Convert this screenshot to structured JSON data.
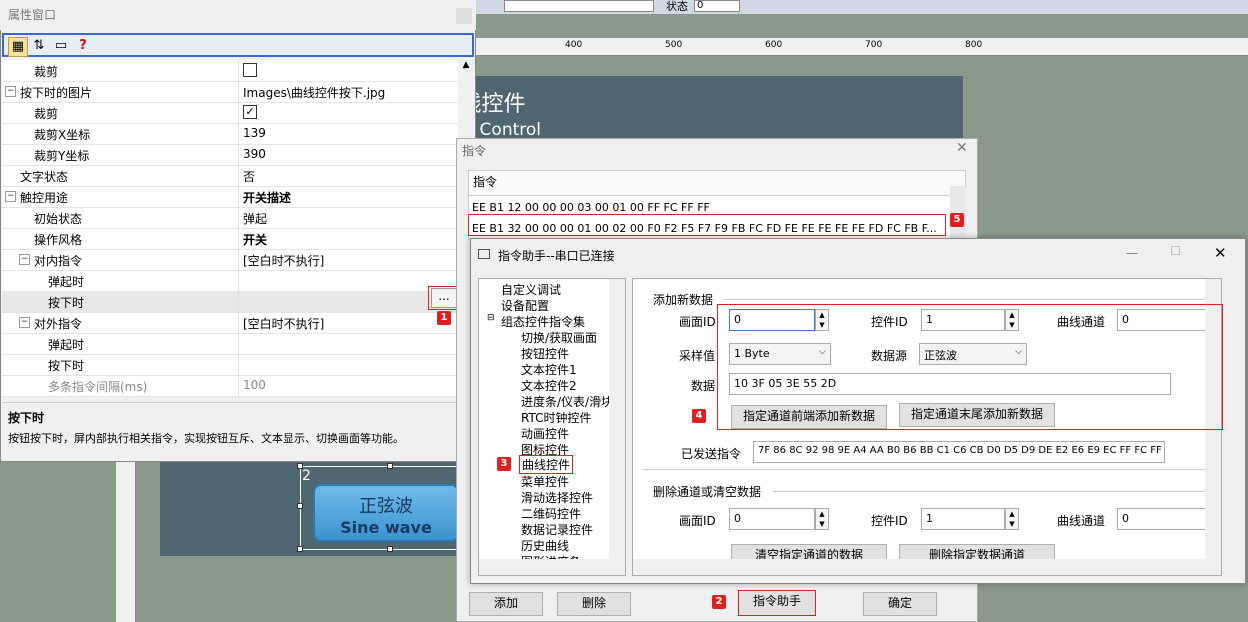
{
  "toolbar_top": {
    "status_label": "状态",
    "status_value": "0"
  },
  "ruler": {
    "ticks": [
      "400",
      "500",
      "600",
      "700",
      "800"
    ]
  },
  "canvas": {
    "title_cn": "曲线控件",
    "title_en": "Graph Control",
    "sine_cn": "正弦波",
    "sine_en": "Sine wave",
    "selection_index": "2"
  },
  "prop_window": {
    "title": "属性窗口",
    "rows": [
      {
        "key": "裁剪",
        "value": ""
      },
      {
        "key": "按下时的图片",
        "value": "Images\\曲线控件按下.jpg"
      },
      {
        "key": "裁剪",
        "value": "✓"
      },
      {
        "key": "裁剪X坐标",
        "value": "139"
      },
      {
        "key": "裁剪Y坐标",
        "value": "390"
      },
      {
        "key": "文字状态",
        "value": "否"
      },
      {
        "key": "触控用途",
        "value": "开关描述"
      },
      {
        "key": "初始状态",
        "value": "弹起"
      },
      {
        "key": "操作风格",
        "value": "开关"
      },
      {
        "key": "对内指令",
        "value": "[空白时不执行]"
      },
      {
        "key": "弹起时",
        "value": ""
      },
      {
        "key": "按下时",
        "value": ""
      },
      {
        "key": "对外指令",
        "value": "[空白时不执行]"
      },
      {
        "key": "弹起时",
        "value": ""
      },
      {
        "key": "按下时",
        "value": ""
      },
      {
        "key": "多条指令间隔(ms)",
        "value": "100"
      }
    ],
    "dots_label": "...",
    "desc_title": "按下时",
    "desc_text": "按钮按下时，屏内部执行相关指令，实现按钮互斥、文本显示、切换画面等功能。"
  },
  "cmd_window": {
    "title": "指令",
    "header": "指令",
    "commands": [
      "EE B1 12 00 00 00 03 00 01 00 FF FC FF FF",
      "EE B1 32 00 00 00 01 00 02 00 F0 F2 F5 F7 F9 FB FC FD FE FE FE FE FE FD FC FB F..."
    ],
    "add_label": "添加",
    "delete_label": "删除",
    "helper_label": "指令助手",
    "ok_label": "确定"
  },
  "helper_window": {
    "title": "指令助手--串口已连接",
    "tree": [
      "自定义调试",
      "设备配置",
      "组态控件指令集",
      "切换/获取画面",
      "按钮控件",
      "文本控件1",
      "文本控件2",
      "进度条/仪表/滑块",
      "RTC时钟控件",
      "动画控件",
      "图标控件",
      "曲线控件",
      "菜单控件",
      "滑动选择控件",
      "二维码控件",
      "数据记录控件",
      "历史曲线",
      "图形进度条"
    ],
    "add_section": "添加新数据",
    "screen_id_label": "画面ID",
    "screen_id_value": "0",
    "control_id_label": "控件ID",
    "control_id_value": "1",
    "channel_label": "曲线通道",
    "channel_value": "0",
    "sample_label": "采样值",
    "sample_value": "1 Byte",
    "source_label": "数据源",
    "source_value": "正弦波",
    "data_label": "数据",
    "data_value": "10 3F 05 3E 55 2D",
    "front_btn": "指定通道前端添加新数据",
    "tail_btn": "指定通道末尾添加新数据",
    "sent_label": "已发送指令",
    "sent_value": "7F 86 8C 92 98 9E A4 AA B0 B6 BB C1 C6 CB D0 D5 D9 DE E2 E6 E9 EC FF FC FF FF",
    "delete_section": "删除通道或清空数据",
    "del_screen_value": "0",
    "del_control_value": "1",
    "del_channel_value": "0",
    "clear_btn": "清空指定通道的数据",
    "del_btn": "删除指定数据通道"
  },
  "badges": [
    "1",
    "2",
    "3",
    "4",
    "5"
  ]
}
